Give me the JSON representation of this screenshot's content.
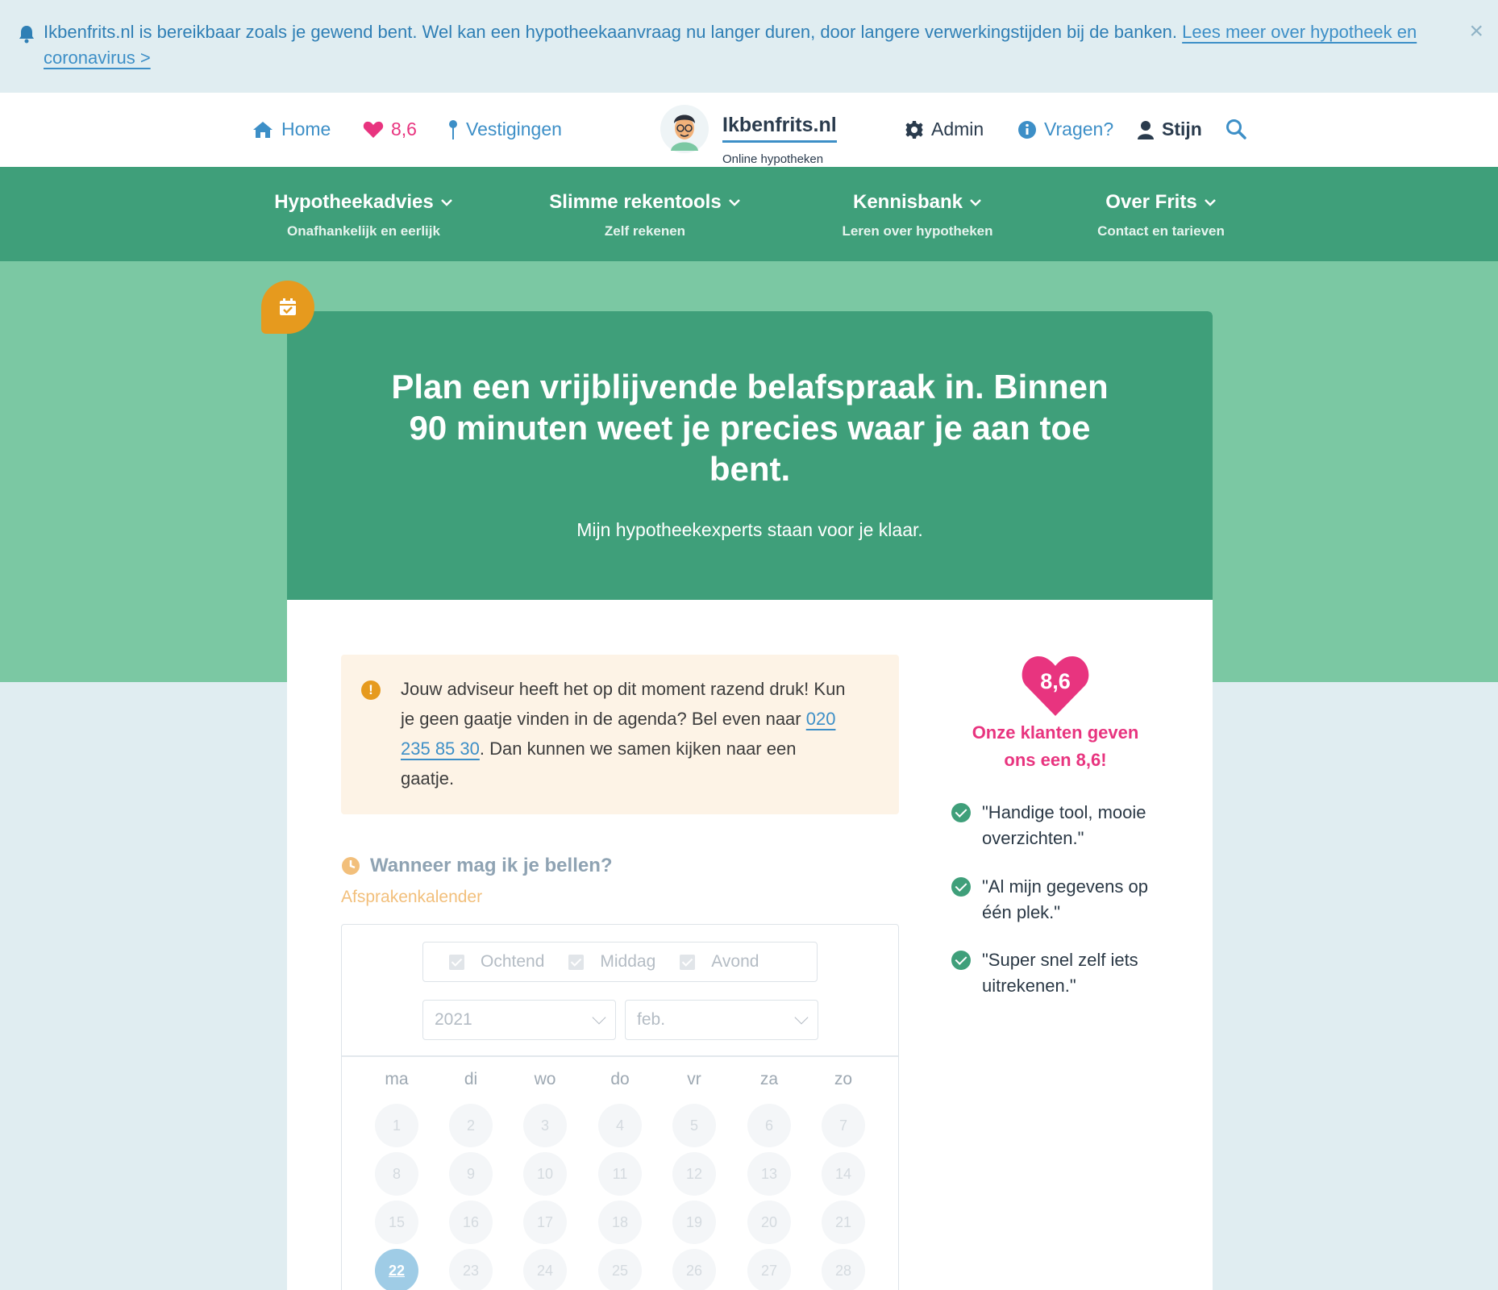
{
  "notice": {
    "text": "Ikbenfrits.nl is bereikbaar zoals je gewend bent. Wel kan een hypotheekaanvraag nu langer duren, door langere verwerkingstijden bij de banken.",
    "link": "Lees meer over hypotheek en coronavirus >",
    "close": "×"
  },
  "topbar": {
    "home": "Home",
    "rating": "8,6",
    "locations": "Vestigingen",
    "logo_name": "Ikbenfrits.nl",
    "logo_sub": "Online hypotheken",
    "admin": "Admin",
    "questions": "Vragen?",
    "user": "Stijn"
  },
  "nav": [
    {
      "title": "Hypotheekadvies",
      "sub": "Onafhankelijk en eerlijk"
    },
    {
      "title": "Slimme rekentools",
      "sub": "Zelf rekenen"
    },
    {
      "title": "Kennisbank",
      "sub": "Leren over hypotheken"
    },
    {
      "title": "Over Frits",
      "sub": "Contact en tarieven"
    }
  ],
  "hero": {
    "title": "Plan een vrijblijvende belafspraak in. Binnen 90 minuten weet je precies waar je aan toe bent.",
    "subtitle": "Mijn hypotheekexperts staan voor je klaar."
  },
  "warning": {
    "text_before": "Jouw adviseur heeft het op dit moment razend druk! Kun je geen gaatje vinden in de agenda? Bel even naar ",
    "phone": "020 235 85 30",
    "text_after": ". Dan kunnen we samen kijken naar een gaatje."
  },
  "scheduler": {
    "title": "Wanneer mag ik je bellen?",
    "agenda_label": "Afsprakenkalender",
    "dayparts": [
      "Ochtend",
      "Middag",
      "Avond"
    ],
    "year": "2021",
    "month": "feb.",
    "weekdays": [
      "ma",
      "di",
      "wo",
      "do",
      "vr",
      "za",
      "zo"
    ],
    "days": [
      "1",
      "2",
      "3",
      "4",
      "5",
      "6",
      "7",
      "8",
      "9",
      "10",
      "11",
      "12",
      "13",
      "14",
      "15",
      "16",
      "17",
      "18",
      "19",
      "20",
      "21",
      "22",
      "23",
      "24",
      "25",
      "26",
      "27",
      "28"
    ],
    "today": "22"
  },
  "reviews": {
    "score": "8,6",
    "caption": "Onze klanten geven ons een 8,6!",
    "quotes": [
      "\"Handige tool, mooie overzichten.\"",
      "\"Al mijn gegevens op één plek.\"",
      "\"Super snel zelf iets uitrekenen.\""
    ]
  },
  "colors": {
    "green": "#3f9f7a",
    "light_green": "#7bc8a3",
    "pink": "#e8347f",
    "blue": "#3d8fc7",
    "orange": "#e69a1e"
  }
}
